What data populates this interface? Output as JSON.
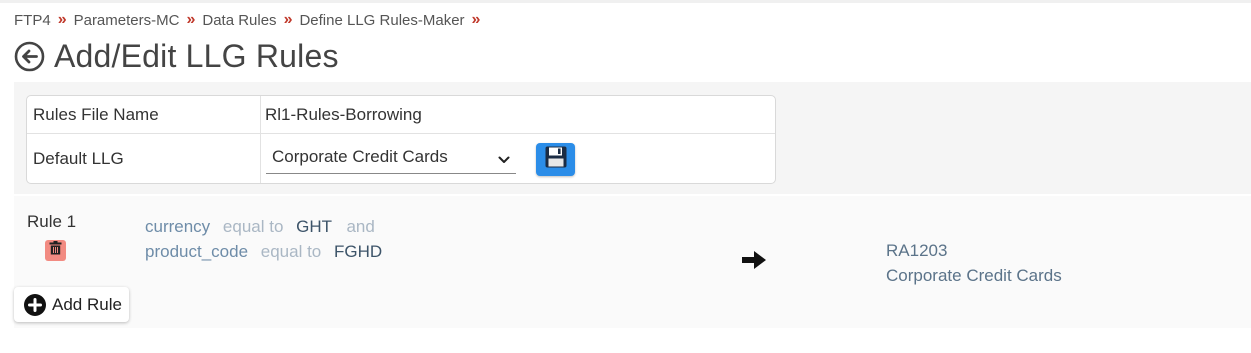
{
  "breadcrumb": {
    "items": [
      "FTP4",
      "Parameters-MC",
      "Data Rules",
      "Define LLG Rules-Maker"
    ],
    "separator": "»"
  },
  "page": {
    "title": "Add/Edit LLG Rules"
  },
  "form": {
    "rules_file_name": {
      "label": "Rules File Name",
      "value": "Rl1-Rules-Borrowing"
    },
    "default_llg": {
      "label": "Default LLG",
      "selected": "Corporate Credit Cards"
    }
  },
  "rules": [
    {
      "label": "Rule 1",
      "conditions": [
        {
          "field": "currency",
          "operator": "equal to",
          "value": "GHT",
          "conjunction": "and"
        },
        {
          "field": "product_code",
          "operator": "equal to",
          "value": "FGHD",
          "conjunction": ""
        }
      ],
      "result": {
        "code": "RA1203",
        "name": "Corporate Credit Cards"
      }
    }
  ],
  "actions": {
    "add_rule_label": "Add Rule"
  },
  "colors": {
    "separator": "#c0392b",
    "save_button": "#2b8de8",
    "delete_button": "#f28b82",
    "field_text": "#6e8ca8"
  },
  "icons": {
    "back": "circle-arrow-left-icon",
    "save": "floppy-disk-icon",
    "delete": "trash-icon",
    "arrow": "arrow-right-icon",
    "add": "plus-circle-icon",
    "select": "chevron-down-icon"
  }
}
